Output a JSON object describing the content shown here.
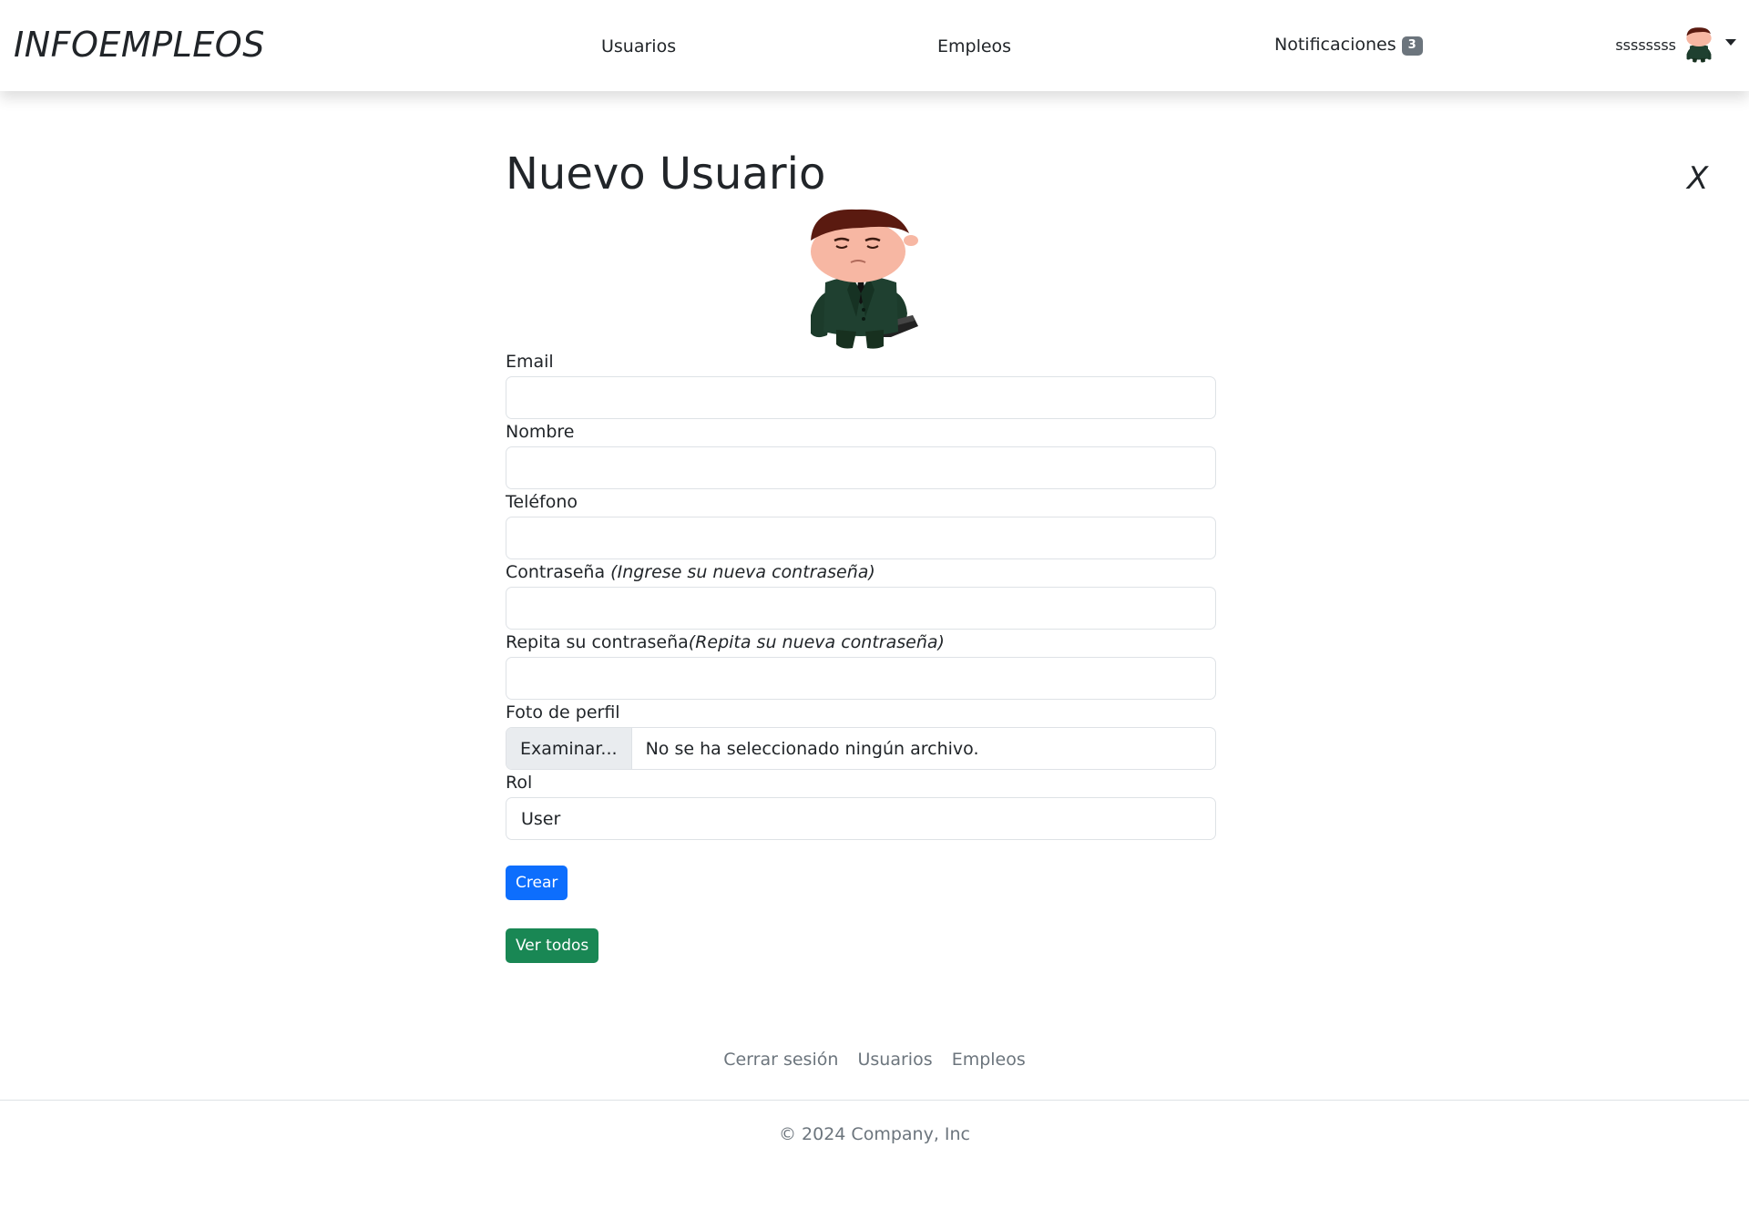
{
  "navbar": {
    "brand": "INFOEMPLEOS",
    "links": [
      {
        "label": "Usuarios"
      },
      {
        "label": "Empleos"
      }
    ],
    "notifications": {
      "label": "Notificaciones",
      "count": "3"
    },
    "user": {
      "name": "ssssssss"
    }
  },
  "page": {
    "title": "Nuevo Usuario",
    "close_label": "X"
  },
  "form": {
    "email_label": "Email",
    "email_value": "",
    "nombre_label": "Nombre",
    "nombre_value": "",
    "telefono_label": "Teléfono",
    "telefono_value": "",
    "password_label": "Contraseña",
    "password_hint": "(Ingrese su nueva contraseña)",
    "password_value": "",
    "repeat_label": "Repita su contraseña",
    "repeat_hint": "(Repita su nueva contraseña)",
    "repeat_value": "",
    "photo_label": "Foto de perfil",
    "photo_button": "Examinar...",
    "photo_status": "No se ha seleccionado ningún archivo.",
    "rol_label": "Rol",
    "rol_selected": "User",
    "submit_label": "Crear",
    "view_all_label": "Ver todos"
  },
  "footer": {
    "links": [
      {
        "label": "Cerrar sesión"
      },
      {
        "label": "Usuarios"
      },
      {
        "label": "Empleos"
      }
    ],
    "copyright": "© 2024 Company, Inc"
  },
  "colors": {
    "primary": "#0d6efd",
    "success": "#198754",
    "badge": "#6c757d"
  }
}
